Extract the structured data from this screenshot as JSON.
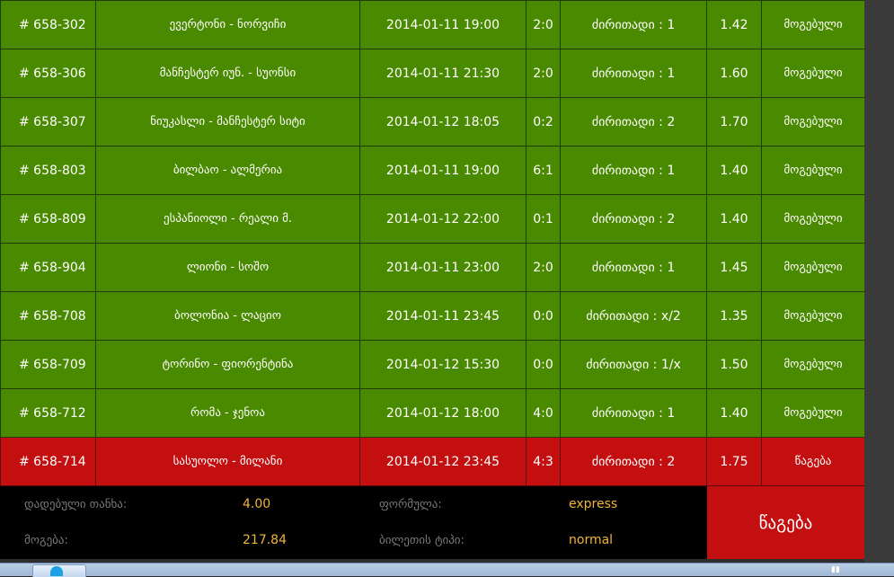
{
  "rows": [
    {
      "id": "# 658-302",
      "match": "ევერტონი - ნორვიჩი",
      "date": "2014-01-11 19:00",
      "score": "2:0",
      "bet": "ძირითადი : 1",
      "odds": "1.42",
      "status": "მოგებული",
      "result": "win"
    },
    {
      "id": "# 658-306",
      "match": "მანჩესტერ იუნ. - სუონსი",
      "date": "2014-01-11 21:30",
      "score": "2:0",
      "bet": "ძირითადი : 1",
      "odds": "1.60",
      "status": "მოგებული",
      "result": "win"
    },
    {
      "id": "# 658-307",
      "match": "ნიუკასლი - მანჩესტერ სიტი",
      "date": "2014-01-12 18:05",
      "score": "0:2",
      "bet": "ძირითადი : 2",
      "odds": "1.70",
      "status": "მოგებული",
      "result": "win"
    },
    {
      "id": "# 658-803",
      "match": "ბილბაო - ალმერია",
      "date": "2014-01-11 19:00",
      "score": "6:1",
      "bet": "ძირითადი : 1",
      "odds": "1.40",
      "status": "მოგებული",
      "result": "win"
    },
    {
      "id": "# 658-809",
      "match": "ესპანიოლი - რეალი მ.",
      "date": "2014-01-12 22:00",
      "score": "0:1",
      "bet": "ძირითადი : 2",
      "odds": "1.40",
      "status": "მოგებული",
      "result": "win"
    },
    {
      "id": "# 658-904",
      "match": "ლიონი - სოშო",
      "date": "2014-01-11 23:00",
      "score": "2:0",
      "bet": "ძირითადი : 1",
      "odds": "1.45",
      "status": "მოგებული",
      "result": "win"
    },
    {
      "id": "# 658-708",
      "match": "ბოლონია - ლაციო",
      "date": "2014-01-11 23:45",
      "score": "0:0",
      "bet": "ძირითადი : x/2",
      "odds": "1.35",
      "status": "მოგებული",
      "result": "win"
    },
    {
      "id": "# 658-709",
      "match": "ტორინო - ფიორენტინა",
      "date": "2014-01-12 15:30",
      "score": "0:0",
      "bet": "ძირითადი : 1/x",
      "odds": "1.50",
      "status": "მოგებული",
      "result": "win"
    },
    {
      "id": "# 658-712",
      "match": "რომა - ჯენოა",
      "date": "2014-01-12 18:00",
      "score": "4:0",
      "bet": "ძირითადი : 1",
      "odds": "1.40",
      "status": "მოგებული",
      "result": "win"
    },
    {
      "id": "# 658-714",
      "match": "სასუოლო - მილანი",
      "date": "2014-01-12 23:45",
      "score": "4:3",
      "bet": "ძირითადი : 2",
      "odds": "1.75",
      "status": "წაგება",
      "result": "lose"
    }
  ],
  "summary": {
    "stake_label": "დადებული თანხა:",
    "stake_value": "4.00",
    "win_label": "მოგება:",
    "win_value": "217.84",
    "formula_label": "ფორმულა:",
    "formula_value": "express",
    "ticket_type_label": "ბილეთის ტიპი:",
    "ticket_type_value": "normal",
    "result_label": "წაგება"
  },
  "colors": {
    "win": "#4a8a00",
    "lose": "#c40f10",
    "value": "#f0b43a"
  }
}
